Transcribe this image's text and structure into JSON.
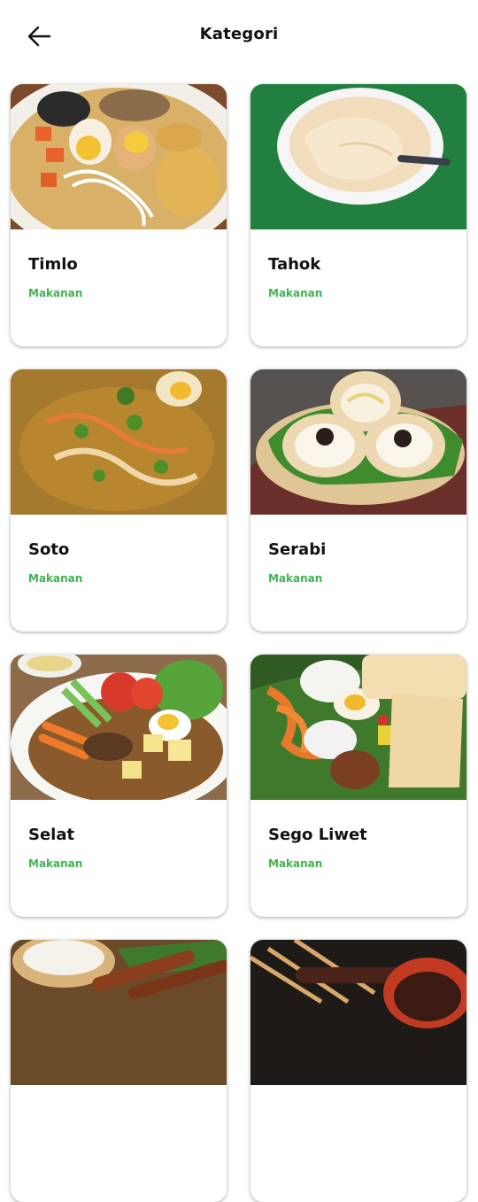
{
  "header": {
    "title": "Kategori",
    "back_icon": "arrow-left-icon"
  },
  "colors": {
    "accent": "#3fb34f",
    "text": "#111111",
    "card_bg": "#ffffff"
  },
  "items": [
    {
      "name": "Timlo",
      "category": "Makanan"
    },
    {
      "name": "Tahok",
      "category": "Makanan"
    },
    {
      "name": "Soto",
      "category": "Makanan"
    },
    {
      "name": "Serabi",
      "category": "Makanan"
    },
    {
      "name": "Selat",
      "category": "Makanan"
    },
    {
      "name": "Sego Liwet",
      "category": "Makanan"
    }
  ]
}
